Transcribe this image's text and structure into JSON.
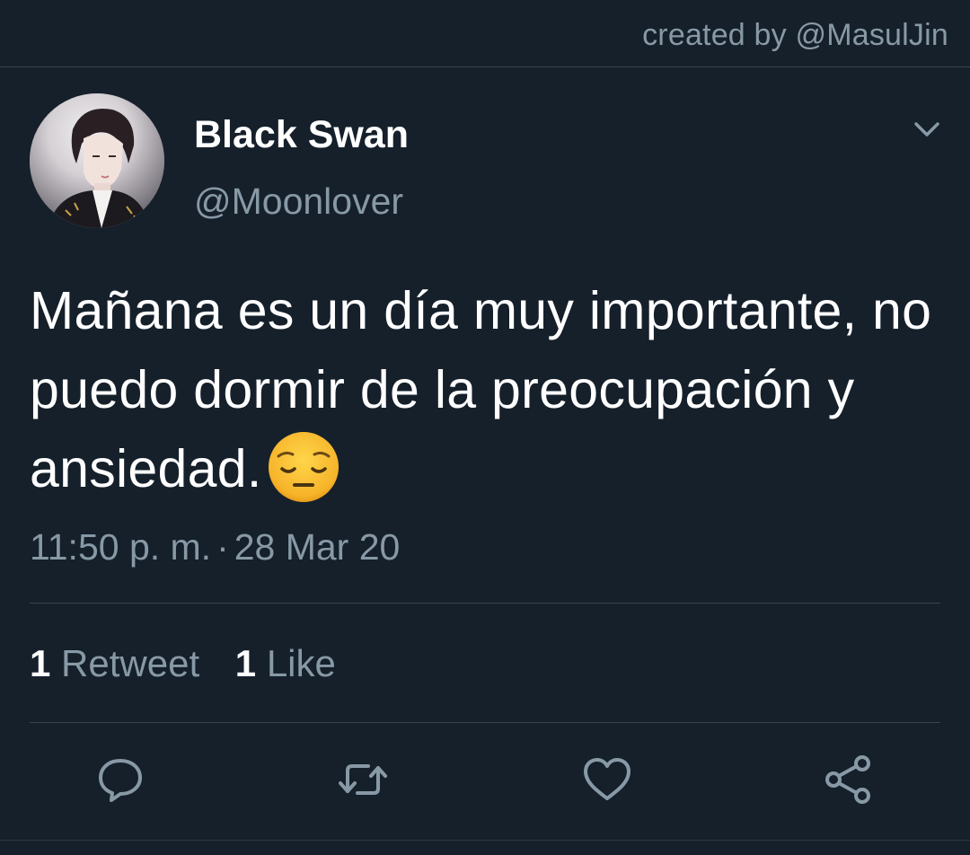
{
  "credit": "created by @MasulJin",
  "tweet": {
    "display_name": "Black Swan",
    "handle": "@Moonlover",
    "text": "Mañana es un día muy importante, no puedo dormir de la preocupación y ansiedad.",
    "emoji": "pensive-face",
    "time": "11:50 p. m.",
    "date": "28 Mar 20"
  },
  "stats": {
    "retweet_count": "1",
    "retweet_label": "Retweet",
    "like_count": "1",
    "like_label": "Like"
  },
  "actions": {
    "reply_icon": "reply-icon",
    "retweet_icon": "retweet-icon",
    "like_icon": "heart-icon",
    "share_icon": "share-icon"
  },
  "colors": {
    "background": "#15202b",
    "secondary_text": "#8899a6",
    "divider": "#38444d"
  }
}
